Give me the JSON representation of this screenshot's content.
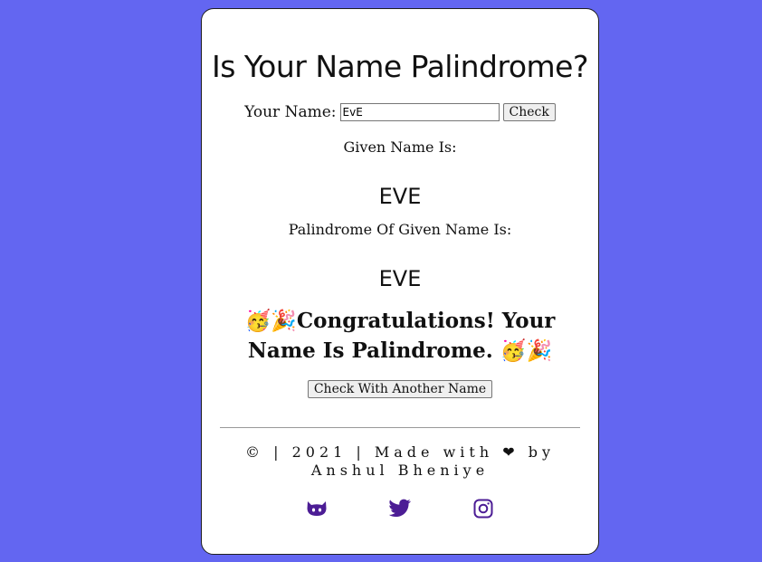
{
  "header": {
    "title": "Is Your Name Palindrome?"
  },
  "form": {
    "label": "Your Name:",
    "input_value": "EvE",
    "check_label": "Check"
  },
  "result": {
    "given_label": "Given Name Is:",
    "given_value": "EVE",
    "palindrome_label": "Palindrome Of Given Name Is:",
    "palindrome_value": "EVE",
    "congrats_text": "🥳🎉Congratulations! Your Name Is Palindrome. 🥳🎉",
    "again_label": "Check With Another Name"
  },
  "footer": {
    "text": "© | 2021 | Made with ❤ by Anshul Bheniye"
  },
  "social": {
    "icons": [
      "github-icon",
      "twitter-icon",
      "instagram-icon"
    ],
    "color": "#4c1d95"
  },
  "colors": {
    "background": "#6366f1",
    "card": "#ffffff"
  }
}
